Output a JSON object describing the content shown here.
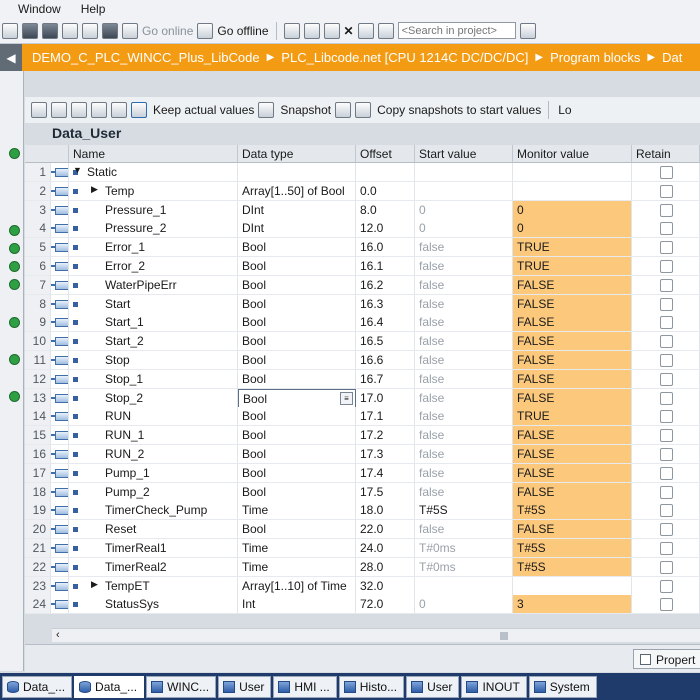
{
  "menu": [
    "Window",
    "Help"
  ],
  "toolbar": {
    "go_online": "Go online",
    "go_offline": "Go offline",
    "search_placeholder": "<Search in project>"
  },
  "breadcrumb": [
    "DEMO_C_PLC_WINCC_Plus_LibCode",
    "PLC_Libcode.net [CPU 1214C DC/DC/DC]",
    "Program blocks",
    "Dat"
  ],
  "editor_toolbar": {
    "keep_actual": "Keep actual values",
    "snapshot": "Snapshot",
    "copy_snapshots": "Copy snapshots to start values",
    "load": "Lo"
  },
  "block_title": "Data_User",
  "columns": {
    "name": "Name",
    "data_type": "Data type",
    "offset": "Offset",
    "start_value": "Start value",
    "monitor_value": "Monitor value",
    "retain": "Retain"
  },
  "rows": [
    {
      "num": "1",
      "name": "Static",
      "type": "",
      "offset": "",
      "start": "",
      "monitor": "",
      "level": 0,
      "expand": "down"
    },
    {
      "num": "2",
      "name": "Temp",
      "type": "Array[1..50] of Bool",
      "offset": "0.0",
      "start": "",
      "monitor": "",
      "level": 1,
      "expand": "right"
    },
    {
      "num": "3",
      "name": "Pressure_1",
      "type": "DInt",
      "offset": "8.0",
      "start": "0",
      "monitor": "0",
      "level": 1
    },
    {
      "num": "4",
      "name": "Pressure_2",
      "type": "DInt",
      "offset": "12.0",
      "start": "0",
      "monitor": "0",
      "level": 1
    },
    {
      "num": "5",
      "name": "Error_1",
      "type": "Bool",
      "offset": "16.0",
      "start": "false",
      "monitor": "TRUE",
      "level": 1
    },
    {
      "num": "6",
      "name": "Error_2",
      "type": "Bool",
      "offset": "16.1",
      "start": "false",
      "monitor": "TRUE",
      "level": 1
    },
    {
      "num": "7",
      "name": "WaterPipeErr",
      "type": "Bool",
      "offset": "16.2",
      "start": "false",
      "monitor": "FALSE",
      "level": 1
    },
    {
      "num": "8",
      "name": "Start",
      "type": "Bool",
      "offset": "16.3",
      "start": "false",
      "monitor": "FALSE",
      "level": 1
    },
    {
      "num": "9",
      "name": "Start_1",
      "type": "Bool",
      "offset": "16.4",
      "start": "false",
      "monitor": "FALSE",
      "level": 1
    },
    {
      "num": "10",
      "name": "Start_2",
      "type": "Bool",
      "offset": "16.5",
      "start": "false",
      "monitor": "FALSE",
      "level": 1
    },
    {
      "num": "11",
      "name": "Stop",
      "type": "Bool",
      "offset": "16.6",
      "start": "false",
      "monitor": "FALSE",
      "level": 1
    },
    {
      "num": "12",
      "name": "Stop_1",
      "type": "Bool",
      "offset": "16.7",
      "start": "false",
      "monitor": "FALSE",
      "level": 1
    },
    {
      "num": "13",
      "name": "Stop_2",
      "type": "Bool",
      "offset": "17.0",
      "start": "false",
      "monitor": "FALSE",
      "level": 1,
      "selected": true
    },
    {
      "num": "14",
      "name": "RUN",
      "type": "Bool",
      "offset": "17.1",
      "start": "false",
      "monitor": "TRUE",
      "level": 1
    },
    {
      "num": "15",
      "name": "RUN_1",
      "type": "Bool",
      "offset": "17.2",
      "start": "false",
      "monitor": "FALSE",
      "level": 1
    },
    {
      "num": "16",
      "name": "RUN_2",
      "type": "Bool",
      "offset": "17.3",
      "start": "false",
      "monitor": "FALSE",
      "level": 1
    },
    {
      "num": "17",
      "name": "Pump_1",
      "type": "Bool",
      "offset": "17.4",
      "start": "false",
      "monitor": "FALSE",
      "level": 1
    },
    {
      "num": "18",
      "name": "Pump_2",
      "type": "Bool",
      "offset": "17.5",
      "start": "false",
      "monitor": "FALSE",
      "level": 1
    },
    {
      "num": "19",
      "name": "TimerCheck_Pump",
      "type": "Time",
      "offset": "18.0",
      "start": "T#5S",
      "monitor": "T#5S",
      "level": 1
    },
    {
      "num": "20",
      "name": "Reset",
      "type": "Bool",
      "offset": "22.0",
      "start": "false",
      "monitor": "FALSE",
      "level": 1
    },
    {
      "num": "21",
      "name": "TimerReal1",
      "type": "Time",
      "offset": "24.0",
      "start": "T#0ms",
      "monitor": "T#5S",
      "level": 1
    },
    {
      "num": "22",
      "name": "TimerReal2",
      "type": "Time",
      "offset": "28.0",
      "start": "T#0ms",
      "monitor": "T#5S",
      "level": 1
    },
    {
      "num": "23",
      "name": "TempET",
      "type": "Array[1..10] of Time",
      "offset": "32.0",
      "start": "",
      "monitor": "",
      "level": 1,
      "expand": "right"
    },
    {
      "num": "24",
      "name": "StatusSys",
      "type": "Int",
      "offset": "72.0",
      "start": "0",
      "monitor": "3",
      "level": 1
    }
  ],
  "properties_button": "Propert",
  "taskbar": [
    "Data_...",
    "Data_...",
    "WINC...",
    "User",
    "HMI ...",
    "Histo...",
    "User",
    "INOUT",
    "System"
  ],
  "colors": {
    "breadcrumb_bg": "#f39b12",
    "monitor_highlight": "#fcc97c",
    "taskbar_bg": "#1f3b6b"
  }
}
